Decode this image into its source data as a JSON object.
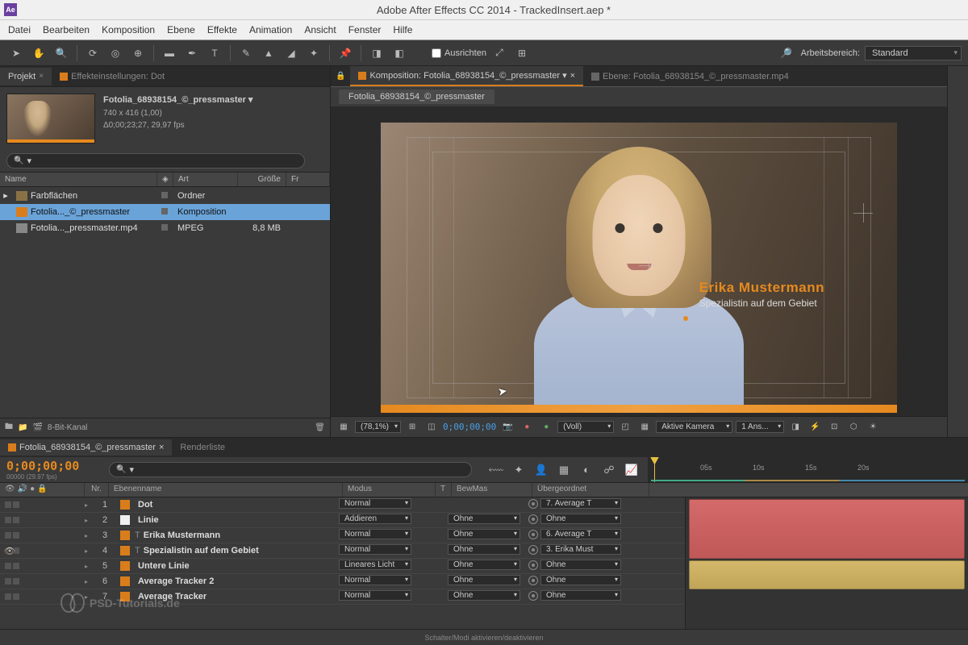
{
  "title": "Adobe After Effects CC 2014 - TrackedInsert.aep *",
  "menu": [
    "Datei",
    "Bearbeiten",
    "Komposition",
    "Ebene",
    "Effekte",
    "Animation",
    "Ansicht",
    "Fenster",
    "Hilfe"
  ],
  "toolbar": {
    "align": "Ausrichten",
    "workspace_label": "Arbeitsbereich:",
    "workspace_value": "Standard"
  },
  "project": {
    "tab_project": "Projekt",
    "tab_effect": "Effekteinstellungen: Dot",
    "comp_name": "Fotolia_68938154_©_pressmaster ▾",
    "dimensions": "740 x 416 (1,00)",
    "duration": "Δ0;00;23;27, 29,97 fps",
    "cols": {
      "name": "Name",
      "type": "Art",
      "size": "Größe",
      "fr": "Fr"
    },
    "items": [
      {
        "name": "Farbflächen",
        "icon": "folder",
        "type": "Ordner",
        "size": ""
      },
      {
        "name": "Fotolia..._©_pressmaster",
        "icon": "comp",
        "type": "Komposition",
        "size": "",
        "selected": true
      },
      {
        "name": "Fotolia..._pressmaster.mp4",
        "icon": "file",
        "type": "MPEG",
        "size": "8,8 MB"
      }
    ],
    "depth": "8-Bit-Kanal"
  },
  "comp": {
    "tab_active": "Komposition: Fotolia_68938154_©_pressmaster ▾",
    "tab_inactive": "Ebene: Fotolia_68938154_©_pressmaster.mp4",
    "breadcrumb": "Fotolia_68938154_©_pressmaster",
    "lt_name": "Erika Mustermann",
    "lt_sub": "Spezialistin auf dem Gebiet",
    "zoom": "(78,1%)",
    "time": "0;00;00;00",
    "res": "(Voll)",
    "camera": "Aktive Kamera",
    "views": "1 Ans..."
  },
  "timeline": {
    "tab_active": "Fotolia_68938154_©_pressmaster",
    "tab_render": "Renderliste",
    "time": "0;00;00;00",
    "time_sub": "00000 (29.97 fps)",
    "ruler": [
      "05s",
      "10s",
      "15s",
      "20s"
    ],
    "cols": {
      "nr": "Nr.",
      "name": "Ebenenname",
      "mode": "Modus",
      "t": "T",
      "trk": "BewMas",
      "parent": "Übergeordnet"
    },
    "modes": {
      "normal": "Normal",
      "add": "Addieren",
      "linear": "Lineares Licht"
    },
    "none": "Ohne",
    "layers": [
      {
        "nr": 1,
        "color": "#d97d1c",
        "name": "Dot",
        "mode": "Normal",
        "trk": "",
        "parent": "7. Average T"
      },
      {
        "nr": 2,
        "color": "#f0f0f0",
        "name": "Linie",
        "mode": "Addieren",
        "trk": "Ohne",
        "parent": "Ohne"
      },
      {
        "nr": 3,
        "color": "#d97d1c",
        "name": "Erika Mustermann",
        "mode": "Normal",
        "trk": "Ohne",
        "parent": "6. Average T",
        "isText": true
      },
      {
        "nr": 4,
        "color": "#d97d1c",
        "name": "Spezialistin auf dem Gebiet",
        "mode": "Normal",
        "trk": "Ohne",
        "parent": "3. Erika Must",
        "isText": true
      },
      {
        "nr": 5,
        "color": "#d97d1c",
        "name": "Untere Linie",
        "mode": "Lineares Licht",
        "trk": "Ohne",
        "parent": "Ohne"
      },
      {
        "nr": 6,
        "color": "#d97d1c",
        "name": "Average Tracker 2",
        "mode": "Normal",
        "trk": "Ohne",
        "parent": "Ohne"
      },
      {
        "nr": 7,
        "color": "#d97d1c",
        "name": "Average Tracker",
        "mode": "Normal",
        "trk": "Ohne",
        "parent": "Ohne"
      }
    ],
    "footer_hint": "Schalter/Modi aktivieren/deaktivieren"
  },
  "watermark": "PSD-Tutorials.de"
}
